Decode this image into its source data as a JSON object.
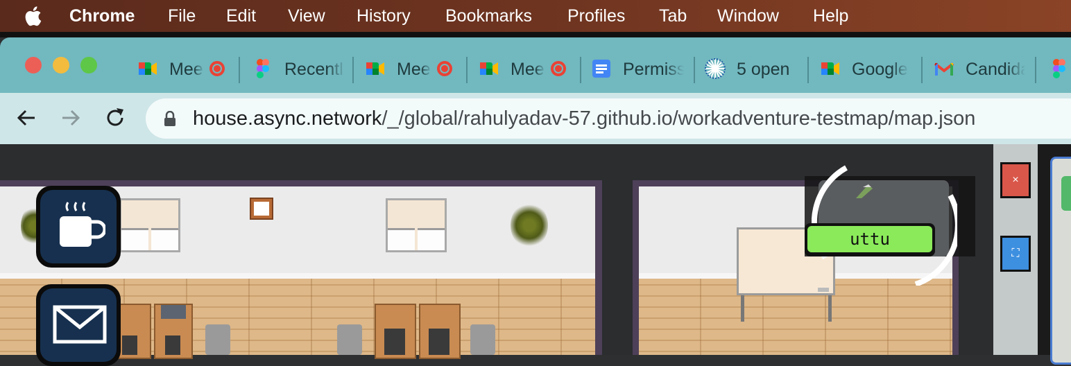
{
  "menubar": {
    "app_name": "Chrome",
    "items": [
      "File",
      "Edit",
      "View",
      "History",
      "Bookmarks",
      "Profiles",
      "Tab",
      "Window",
      "Help"
    ]
  },
  "tabs": [
    {
      "label": "Mee",
      "icon": "google-meet-icon",
      "recording": true
    },
    {
      "label": "Recentl",
      "icon": "figma-icon",
      "recording": false
    },
    {
      "label": "Mee",
      "icon": "google-meet-icon",
      "recording": true
    },
    {
      "label": "Mee",
      "icon": "google-meet-icon",
      "recording": true
    },
    {
      "label": "Permiss",
      "icon": "google-docs-icon",
      "recording": false
    },
    {
      "label": "5 open",
      "icon": "starburst-icon",
      "recording": false
    },
    {
      "label": "Google",
      "icon": "google-meet-icon",
      "recording": false
    },
    {
      "label": "Candida",
      "icon": "gmail-icon",
      "recording": false
    }
  ],
  "address_bar": {
    "host": "house.async.network",
    "path": "/_/global/rahulyadav-57.github.io/workadventure-testmap/map.json"
  },
  "game": {
    "player_name": "uttu",
    "close_button_glyph": "×",
    "fullscreen_button_glyph": "⛶"
  },
  "colors": {
    "menubar": "#6e3420",
    "tabbar": "#72b8bf",
    "toolbar": "#cfe6e8",
    "nametag": "#8bea5a",
    "close_btn": "#d9574a",
    "fullscreen_btn": "#3d8fe0"
  }
}
